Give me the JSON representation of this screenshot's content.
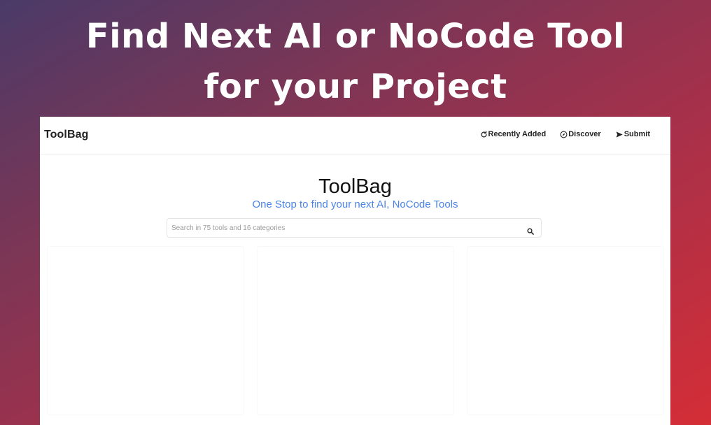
{
  "headline": {
    "line1": "Find Next AI or NoCode Tool",
    "line2": "for your Project"
  },
  "navbar": {
    "brand": "ToolBag",
    "links": [
      {
        "label": "Recently Added",
        "icon": "refresh-icon"
      },
      {
        "label": "Discover",
        "icon": "compass-icon"
      },
      {
        "label": "Submit",
        "icon": "send-icon"
      }
    ]
  },
  "hero": {
    "title": "ToolBag",
    "subtitle": "One Stop to find your next AI, NoCode Tools"
  },
  "search": {
    "placeholder": "Search in 75 tools and 16 categories",
    "value": "",
    "icon": "search-icon"
  },
  "colors": {
    "subtitle": "#4a84e6",
    "background_start": "#4a3a68",
    "background_end": "#d42e36"
  }
}
